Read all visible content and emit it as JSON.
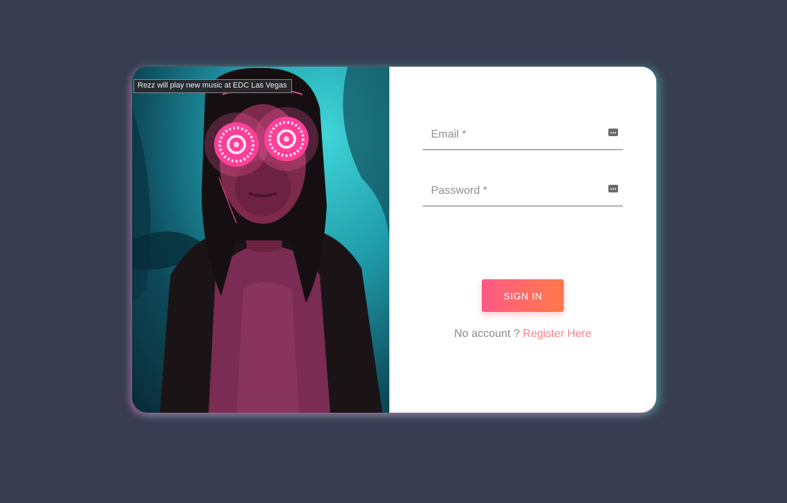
{
  "photo": {
    "caption": "Rezz will play new music at EDC Las Vegas"
  },
  "form": {
    "email_label": "Email *",
    "password_label": "Password *",
    "signin_label": "SIGN IN",
    "no_account_text": "No account ?",
    "register_link": "Register Here"
  },
  "colors": {
    "background": "#393d50",
    "button_gradient_start": "#fe5a85",
    "button_gradient_end": "#ff7a4a",
    "link": "#ff7d86"
  },
  "icons": [
    "password-manager-key-icon"
  ]
}
